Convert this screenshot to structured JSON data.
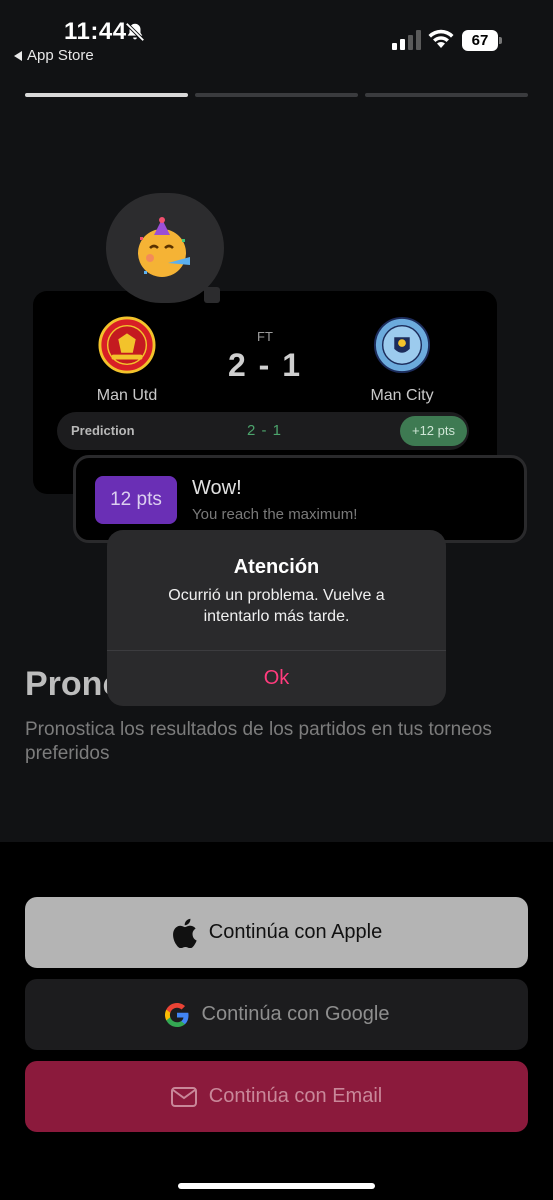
{
  "status_bar": {
    "time": "11:44",
    "back_label": "App Store",
    "battery": "67"
  },
  "onboarding": {
    "progress_steps": 3,
    "active_step": 1,
    "headline": "Pronostica",
    "subtext": "Pronostica los resultados de los partidos en tus torneos preferidos"
  },
  "match": {
    "status": "FT",
    "score": "2 - 1",
    "home_team": "Man Utd",
    "away_team": "Man City",
    "prediction_label": "Prediction",
    "prediction_score": "2 - 1",
    "prediction_points": "+12 pts"
  },
  "toast": {
    "points": "12 pts",
    "title": "Wow!",
    "subtitle": "You reach the maximum!"
  },
  "alert": {
    "title": "Atención",
    "message": "Ocurrió un problema. Vuelve a intentarlo más tarde.",
    "ok_label": "Ok"
  },
  "buttons": {
    "apple": "Continúa con Apple",
    "google": "Continúa con Google",
    "email": "Continúa con Email"
  },
  "colors": {
    "accent_pink": "#ff3b7d",
    "email_button": "#8b1a3c",
    "points_purple": "#6a2fb5",
    "prediction_green": "#4ca46c"
  },
  "icons": {
    "emoji": "party-face-icon",
    "apple": "apple-icon",
    "google": "google-icon",
    "email": "mail-icon"
  }
}
